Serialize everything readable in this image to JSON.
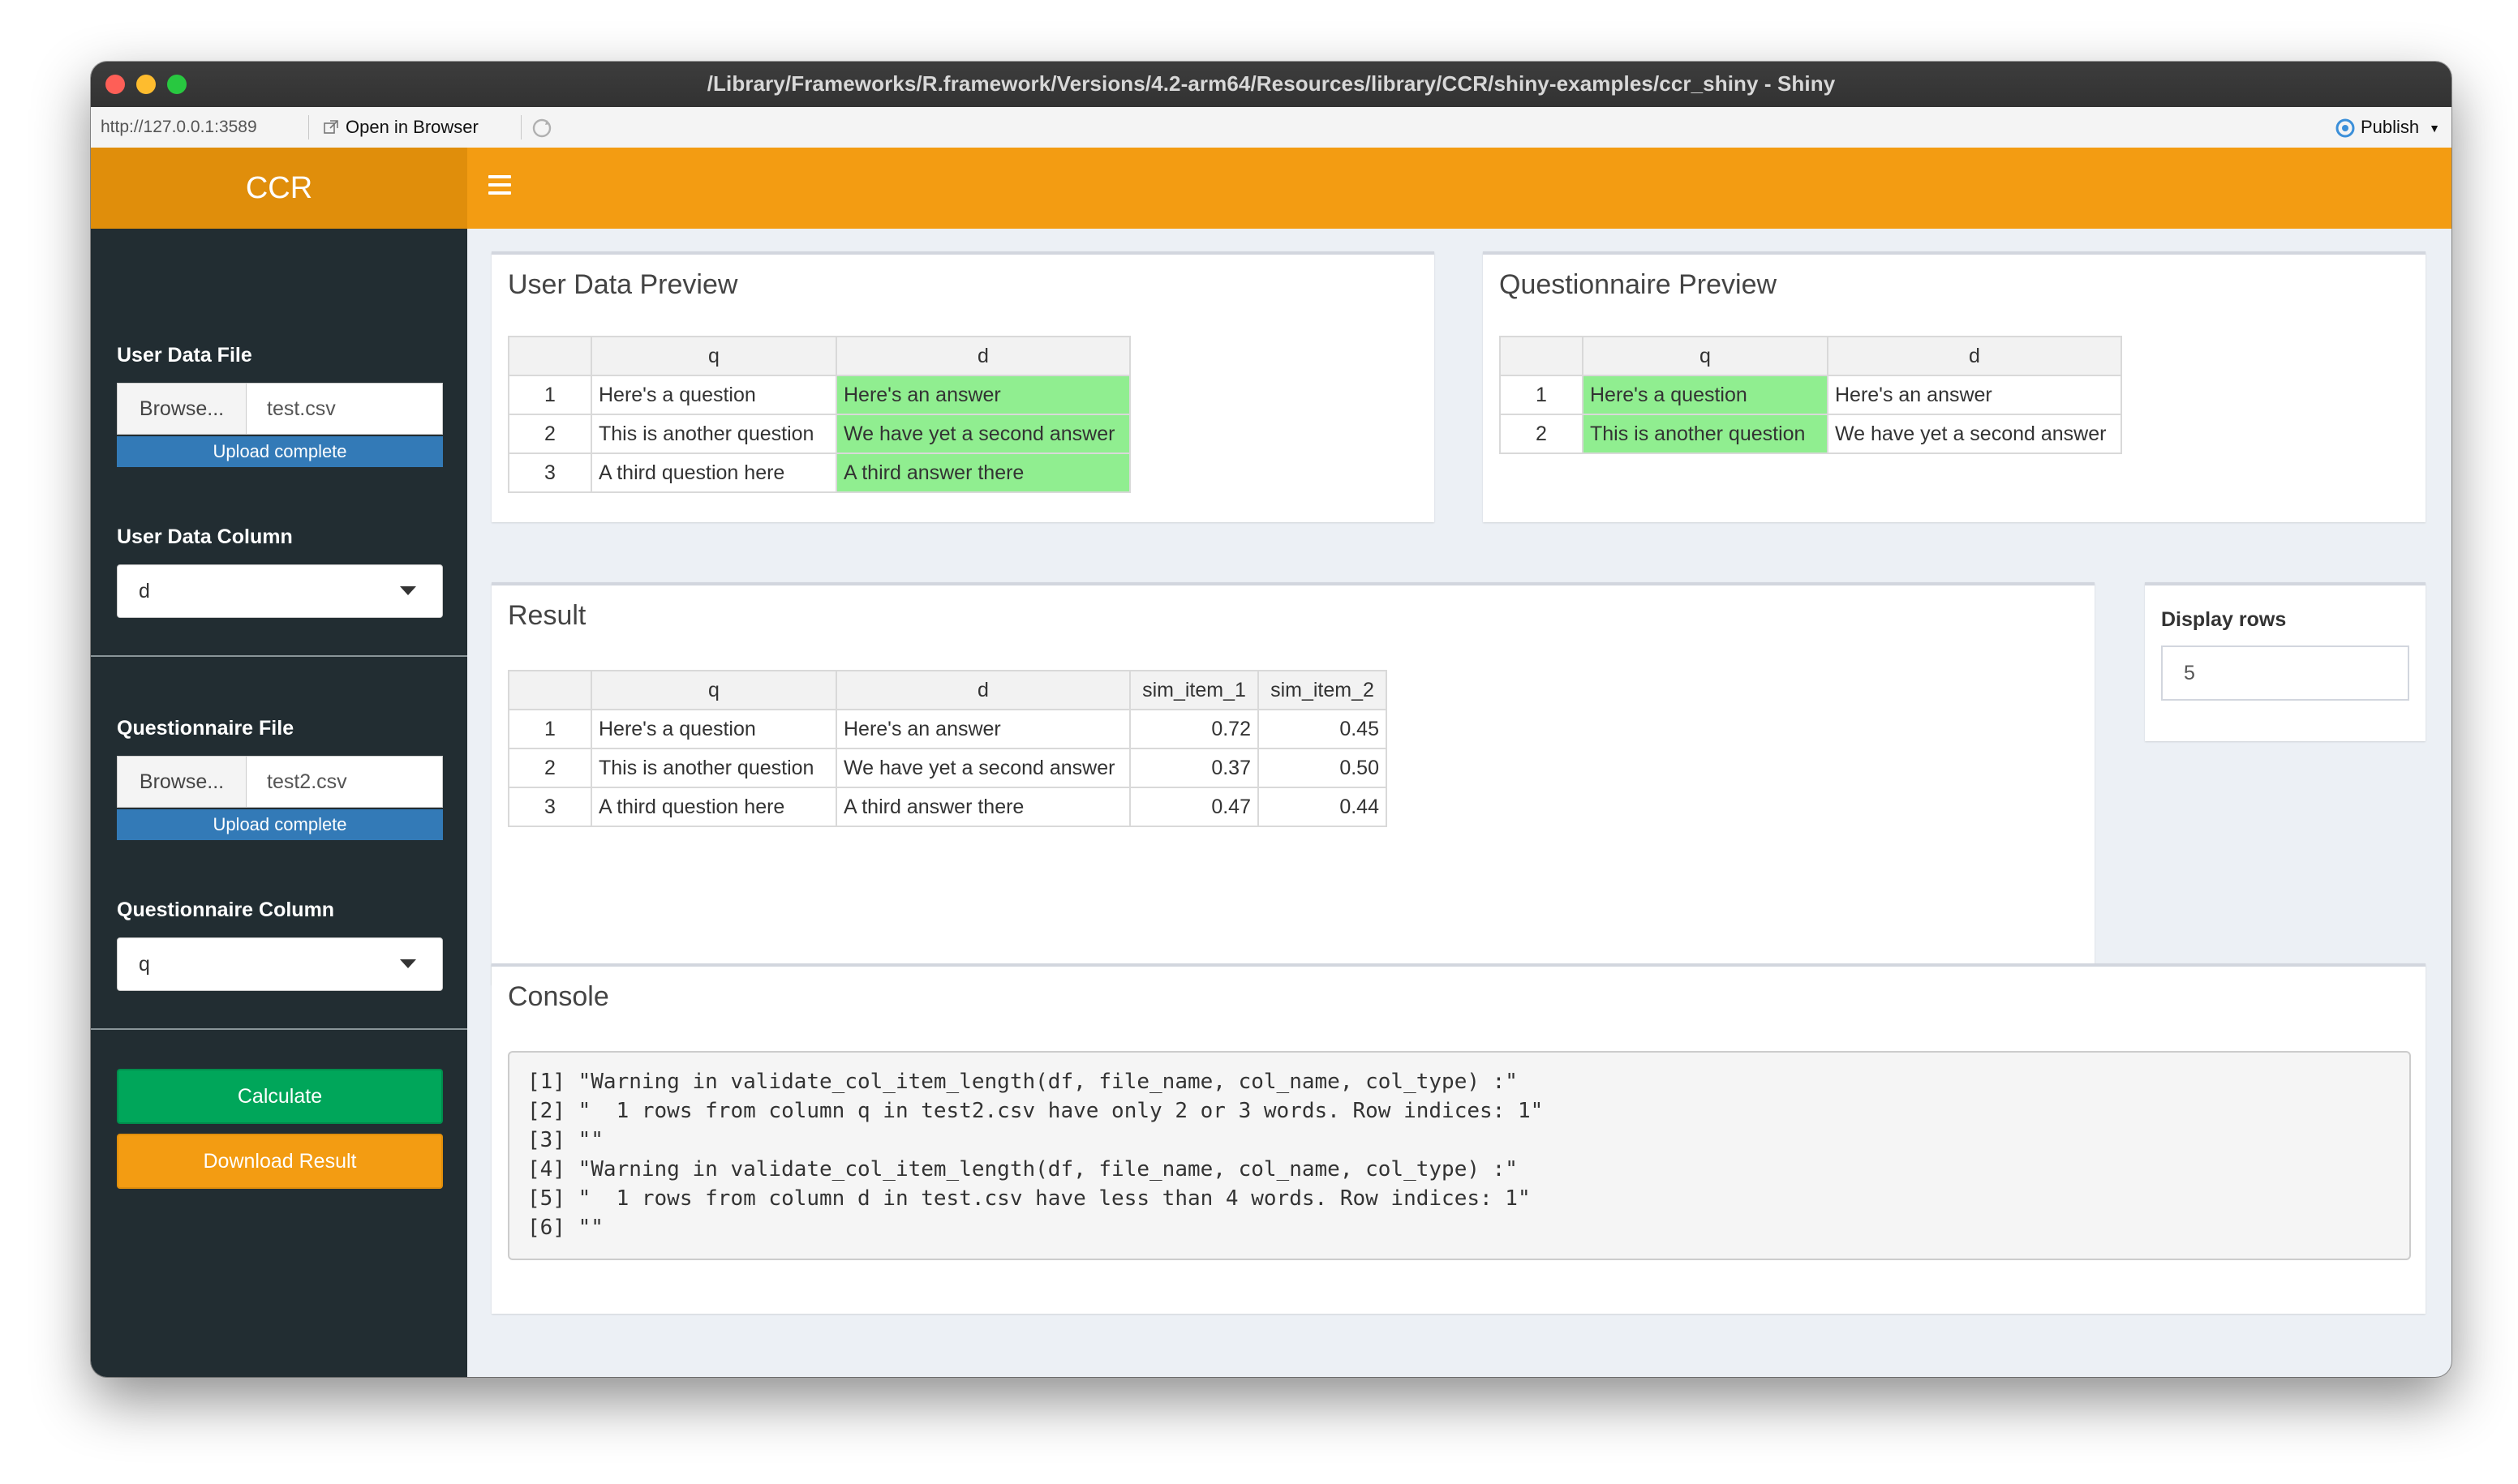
{
  "window": {
    "title": "/Library/Frameworks/R.framework/Versions/4.2-arm64/Resources/library/CCR/shiny-examples/ccr_shiny - Shiny"
  },
  "toolbar": {
    "url": "http://127.0.0.1:3589",
    "open_in_browser": "Open in Browser",
    "publish": "Publish"
  },
  "header": {
    "logo": "CCR"
  },
  "sidebar": {
    "user_data_file_label": "User Data File",
    "user_data_browse": "Browse...",
    "user_data_filename": "test.csv",
    "user_data_progress": "Upload complete",
    "user_data_column_label": "User Data Column",
    "user_data_column_value": "d",
    "questionnaire_file_label": "Questionnaire File",
    "questionnaire_browse": "Browse...",
    "questionnaire_filename": "test2.csv",
    "questionnaire_progress": "Upload complete",
    "questionnaire_column_label": "Questionnaire Column",
    "questionnaire_column_value": "q",
    "calculate_label": "Calculate",
    "download_label": "Download Result"
  },
  "user_preview": {
    "title": "User Data Preview",
    "columns": [
      "",
      "q",
      "d"
    ],
    "rows": [
      [
        "1",
        "Here's a question",
        "Here's an answer"
      ],
      [
        "2",
        "This is another question",
        "We have yet a second answer"
      ],
      [
        "3",
        "A third question here",
        "A third answer there"
      ]
    ]
  },
  "questionnaire_preview": {
    "title": "Questionnaire Preview",
    "columns": [
      "",
      "q",
      "d"
    ],
    "rows": [
      [
        "1",
        "Here's a question",
        "Here's an answer"
      ],
      [
        "2",
        "This is another question",
        "We have yet a second answer"
      ]
    ]
  },
  "result": {
    "title": "Result",
    "columns": [
      "",
      "q",
      "d",
      "sim_item_1",
      "sim_item_2"
    ],
    "rows": [
      [
        "1",
        "Here's a question",
        "Here's an answer",
        "0.72",
        "0.45"
      ],
      [
        "2",
        "This is another question",
        "We have yet a second answer",
        "0.37",
        "0.50"
      ],
      [
        "3",
        "A third question here",
        "A third answer there",
        "0.47",
        "0.44"
      ]
    ]
  },
  "display_rows": {
    "label": "Display rows",
    "value": "5"
  },
  "console": {
    "title": "Console",
    "lines": [
      "[1] \"Warning in validate_col_item_length(df, file_name, col_name, col_type) :\"",
      "[2] \"  1 rows from column q in test2.csv have only 2 or 3 words. Row indices: 1\"",
      "[3] \"\"",
      "[4] \"Warning in validate_col_item_length(df, file_name, col_name, col_type) :\"",
      "[5] \"  1 rows from column d in test.csv have less than 4 words. Row indices: 1\"",
      "[6] \"\""
    ]
  },
  "colors": {
    "header": "#f39c12",
    "logo_bg": "#e08e0b",
    "sidebar": "#222d32",
    "highlight": "#90ee90",
    "progress": "#337ab7",
    "calculate": "#00a65a"
  }
}
